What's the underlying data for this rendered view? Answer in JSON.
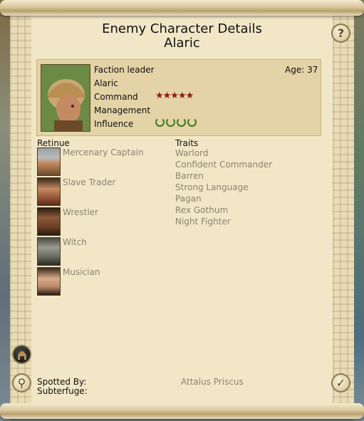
{
  "window": {
    "title": "Enemy Character Details",
    "character_name": "Alaric"
  },
  "character": {
    "role": "Faction leader",
    "name": "Alaric",
    "age_text": "Age: 37",
    "command_label": "Command",
    "command_rating": 5,
    "command_stars": "★★★★★",
    "management_label": "Management",
    "influence_label": "Influence",
    "influence_rating": 4
  },
  "retinue": {
    "heading": "Retinue",
    "items": [
      {
        "name": "Mercenary Captain",
        "icon": "mercenary-captain-portrait"
      },
      {
        "name": "Slave Trader",
        "icon": "slave-trader-portrait"
      },
      {
        "name": "Wrestler",
        "icon": "wrestler-portrait"
      },
      {
        "name": "Witch",
        "icon": "witch-portrait"
      },
      {
        "name": "Musician",
        "icon": "musician-portrait"
      }
    ]
  },
  "traits": {
    "heading": "Traits",
    "items": [
      "Warlord",
      "Confident Commander",
      "Barren",
      "Strong Language",
      "Pagan",
      "Rex Gothum",
      "Night Fighter"
    ]
  },
  "footer": {
    "spotted_by_label": "Spotted By:",
    "spotted_by_value": "Attalus Priscus",
    "subterfuge_label": "Subterfuge:"
  },
  "buttons": {
    "help_glyph": "?",
    "confirm_glyph": "✓",
    "zoom_glyph": "⚲"
  },
  "colors": {
    "parchment": "#f1e7c6",
    "panel": "#e3d3a6",
    "star": "#8b1a10",
    "laurel": "#3a7d1a",
    "muted_text": "#8a8470"
  }
}
